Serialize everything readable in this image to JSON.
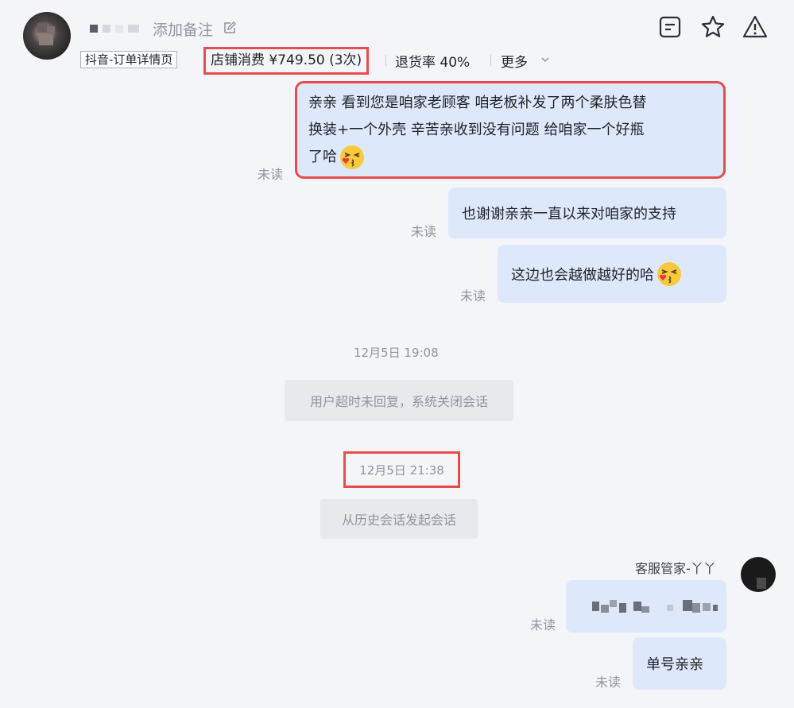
{
  "header": {
    "customer_name_masked": "",
    "add_note_label": "添加备注",
    "source_tag": "抖音-订单详情页",
    "store_spend": "店铺消费 ¥749.50 (3次)",
    "return_rate": "退货率 40%",
    "more_label": "更多",
    "icons": [
      "notes-icon",
      "star-icon",
      "warning-icon",
      "edit-icon",
      "chevron-down-icon"
    ]
  },
  "messages": [
    {
      "line1": "亲亲 看到您是咱家老顾客 咱老板补发了两个柔肤色替",
      "line2": "换装+一个外壳  辛苦亲收到没有问题 给咱家一个好瓶",
      "line3": "了哈",
      "status": "未读"
    },
    {
      "text": "也谢谢亲亲一直以来对咱家的支持",
      "status": "未读"
    },
    {
      "text": "这边也会越做越好的哈",
      "status": "未读"
    }
  ],
  "system": {
    "time1": "12月5日 19:08",
    "notice1": "用户超时未回复，系统关闭会话",
    "time2": "12月5日 21:38",
    "notice2": "从历史会话发起会话"
  },
  "agent": {
    "name": "客服管家-丫丫",
    "masked_message_status": "未读",
    "last_message": "单号亲亲",
    "last_status": "未读"
  },
  "colors": {
    "bubble": "#dde9fb",
    "highlight_box": "#e84c4c",
    "background": "#f4f5f9"
  }
}
